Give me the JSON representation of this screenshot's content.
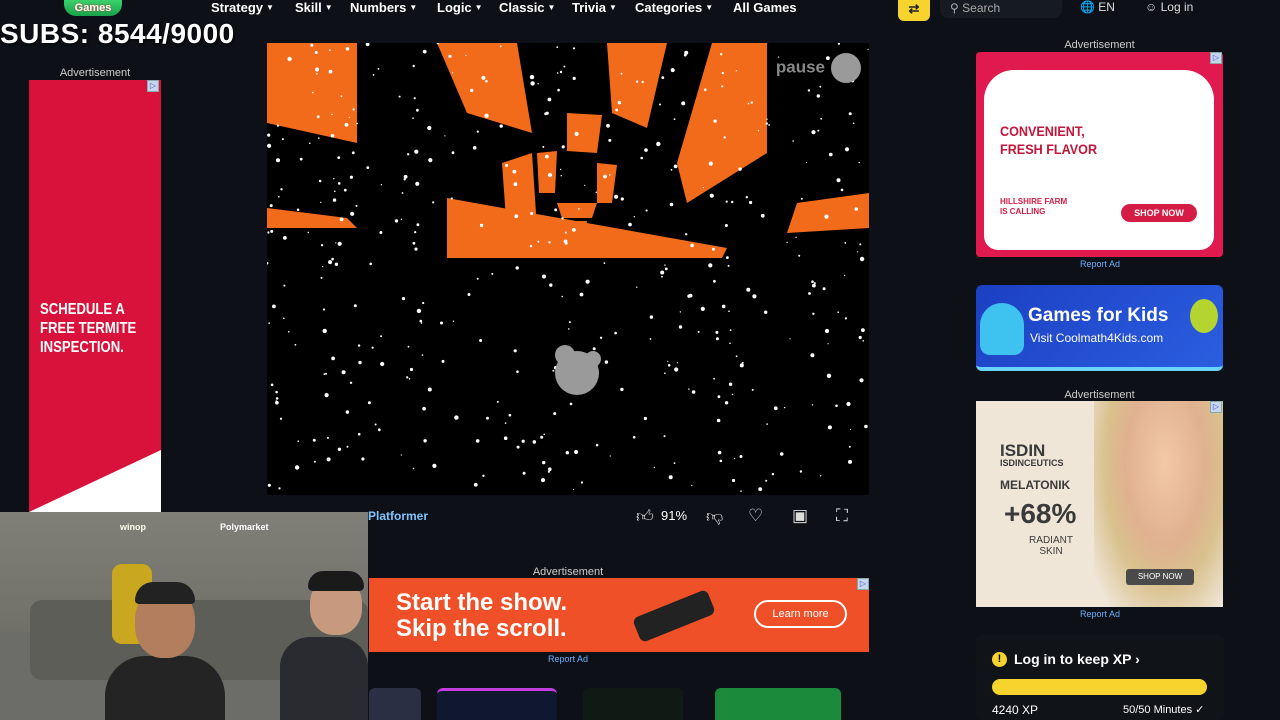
{
  "topnav": {
    "logo": "Games",
    "items": [
      {
        "label": "Strategy",
        "dropdown": true
      },
      {
        "label": "Skill",
        "dropdown": true
      },
      {
        "label": "Numbers",
        "dropdown": true
      },
      {
        "label": "Logic",
        "dropdown": true
      },
      {
        "label": "Classic",
        "dropdown": true
      },
      {
        "label": "Trivia",
        "dropdown": true
      },
      {
        "label": "Categories",
        "dropdown": true
      },
      {
        "label": "All Games",
        "dropdown": false
      }
    ],
    "search_placeholder": "Search",
    "language": "EN",
    "login": "Log in"
  },
  "overlay": {
    "subs": "SUBS: 8544/9000"
  },
  "ads": {
    "label": "Advertisement",
    "report": "Report Ad",
    "left": {
      "text": "SCHEDULE A FREE TERMITE INSPECTION."
    },
    "right_top": {
      "headline": "CONVENIENT, FRESH FLAVOR",
      "brand": "HILLSHIRE FARM",
      "tag": "IS CALLING",
      "cta": "SHOP NOW"
    },
    "right_bottom": {
      "brand": "ISDIN",
      "brand_sub": "ISDINCEUTICS",
      "product": "MELATONIK",
      "percent": "+68%",
      "claim": "RADIANT SKIN",
      "cta": "SHOP NOW"
    },
    "bottom": {
      "headline1": "Start the show.",
      "headline2": "Skip the scroll.",
      "cta": "Learn more"
    }
  },
  "kids_banner": {
    "title": "Games for Kids",
    "subtitle": "Visit Coolmath4Kids.com"
  },
  "game": {
    "pause_label": "pause",
    "category": "Platformer",
    "rating": "91%",
    "colors": {
      "tunnel": "#f26b1b",
      "background": "#000000"
    }
  },
  "xp": {
    "title": "Log in to keep XP",
    "xp_value": "4240 XP",
    "minutes": "50/50 Minutes",
    "progress": 1.0
  },
  "webcam": {
    "sponsor1": "winop",
    "sponsor2": "Polymarket"
  }
}
